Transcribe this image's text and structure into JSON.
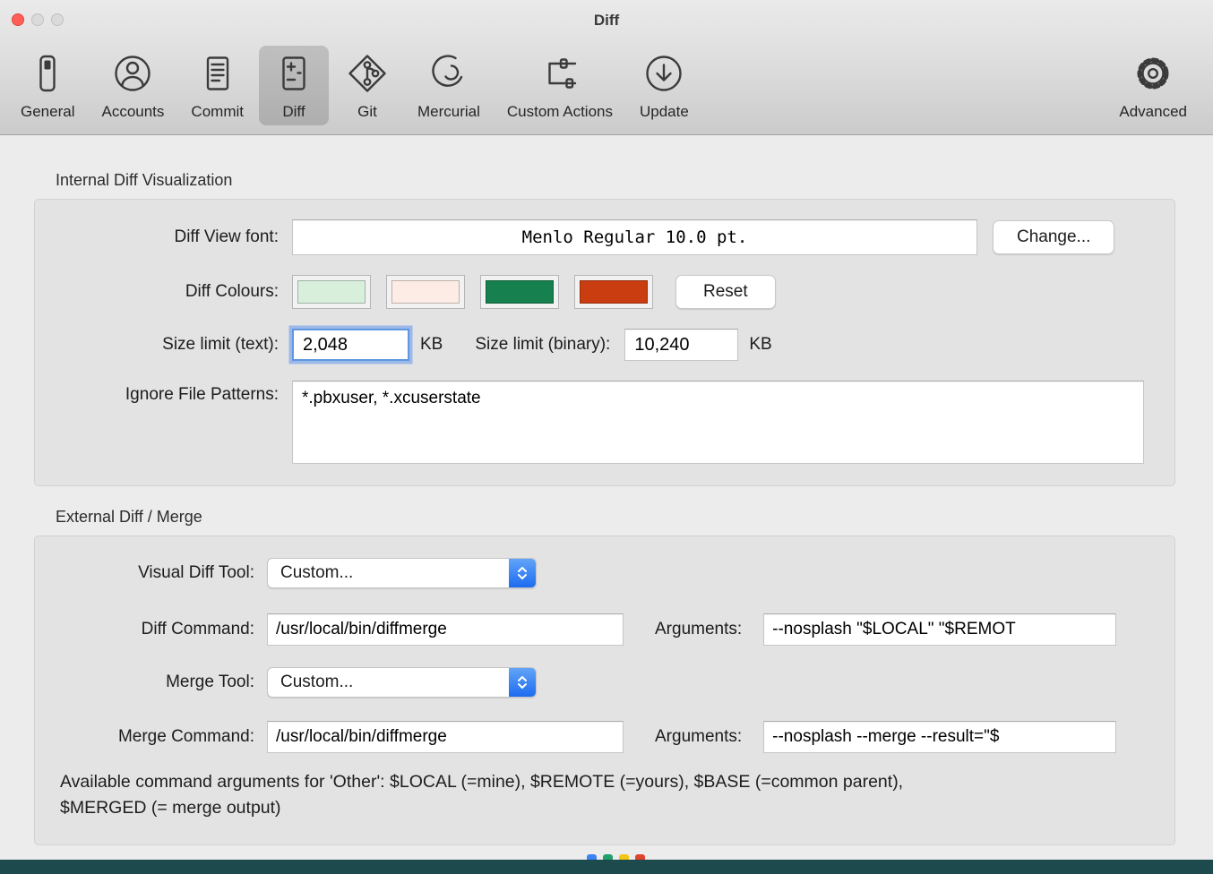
{
  "window": {
    "title": "Diff"
  },
  "toolbar": {
    "items": [
      {
        "label": "General"
      },
      {
        "label": "Accounts"
      },
      {
        "label": "Commit"
      },
      {
        "label": "Diff",
        "selected": true
      },
      {
        "label": "Git"
      },
      {
        "label": "Mercurial"
      },
      {
        "label": "Custom Actions"
      },
      {
        "label": "Update"
      }
    ],
    "advanced": {
      "label": "Advanced"
    }
  },
  "internal": {
    "section_title": "Internal Diff Visualization",
    "font_label": "Diff View font:",
    "font_value": "Menlo Regular 10.0 pt.",
    "change_label": "Change...",
    "colours_label": "Diff Colours:",
    "colors": [
      "#d8efdc",
      "#fcece5",
      "#16804e",
      "#c93d10"
    ],
    "reset_label": "Reset",
    "size_text_label": "Size limit (text):",
    "size_text_value": "2,048",
    "size_text_unit": "KB",
    "size_binary_label": "Size limit (binary):",
    "size_binary_value": "10,240",
    "size_binary_unit": "KB",
    "ignore_label": "Ignore File Patterns:",
    "ignore_value": "*.pbxuser, *.xcuserstate"
  },
  "external": {
    "section_title": "External Diff / Merge",
    "visual_tool_label": "Visual Diff Tool:",
    "visual_tool_value": "Custom...",
    "diff_cmd_label": "Diff Command:",
    "diff_cmd_value": "/usr/local/bin/diffmerge",
    "diff_args_label": "Arguments:",
    "diff_args_value": "--nosplash \"$LOCAL\" \"$REMOT",
    "merge_tool_label": "Merge Tool:",
    "merge_tool_value": "Custom...",
    "merge_cmd_label": "Merge Command:",
    "merge_cmd_value": "/usr/local/bin/diffmerge",
    "merge_args_label": "Arguments:",
    "merge_args_value": "--nosplash --merge --result=\"$",
    "help_text": "Available command arguments for 'Other': $LOCAL (=mine), $REMOTE (=yours), $BASE (=common parent), $MERGED (= merge output)"
  },
  "misc": {
    "strip_color": "#1d4a4c",
    "peek_colors": [
      "#3b82f6",
      "#22a06b",
      "#f5c515",
      "#e0442e"
    ]
  }
}
